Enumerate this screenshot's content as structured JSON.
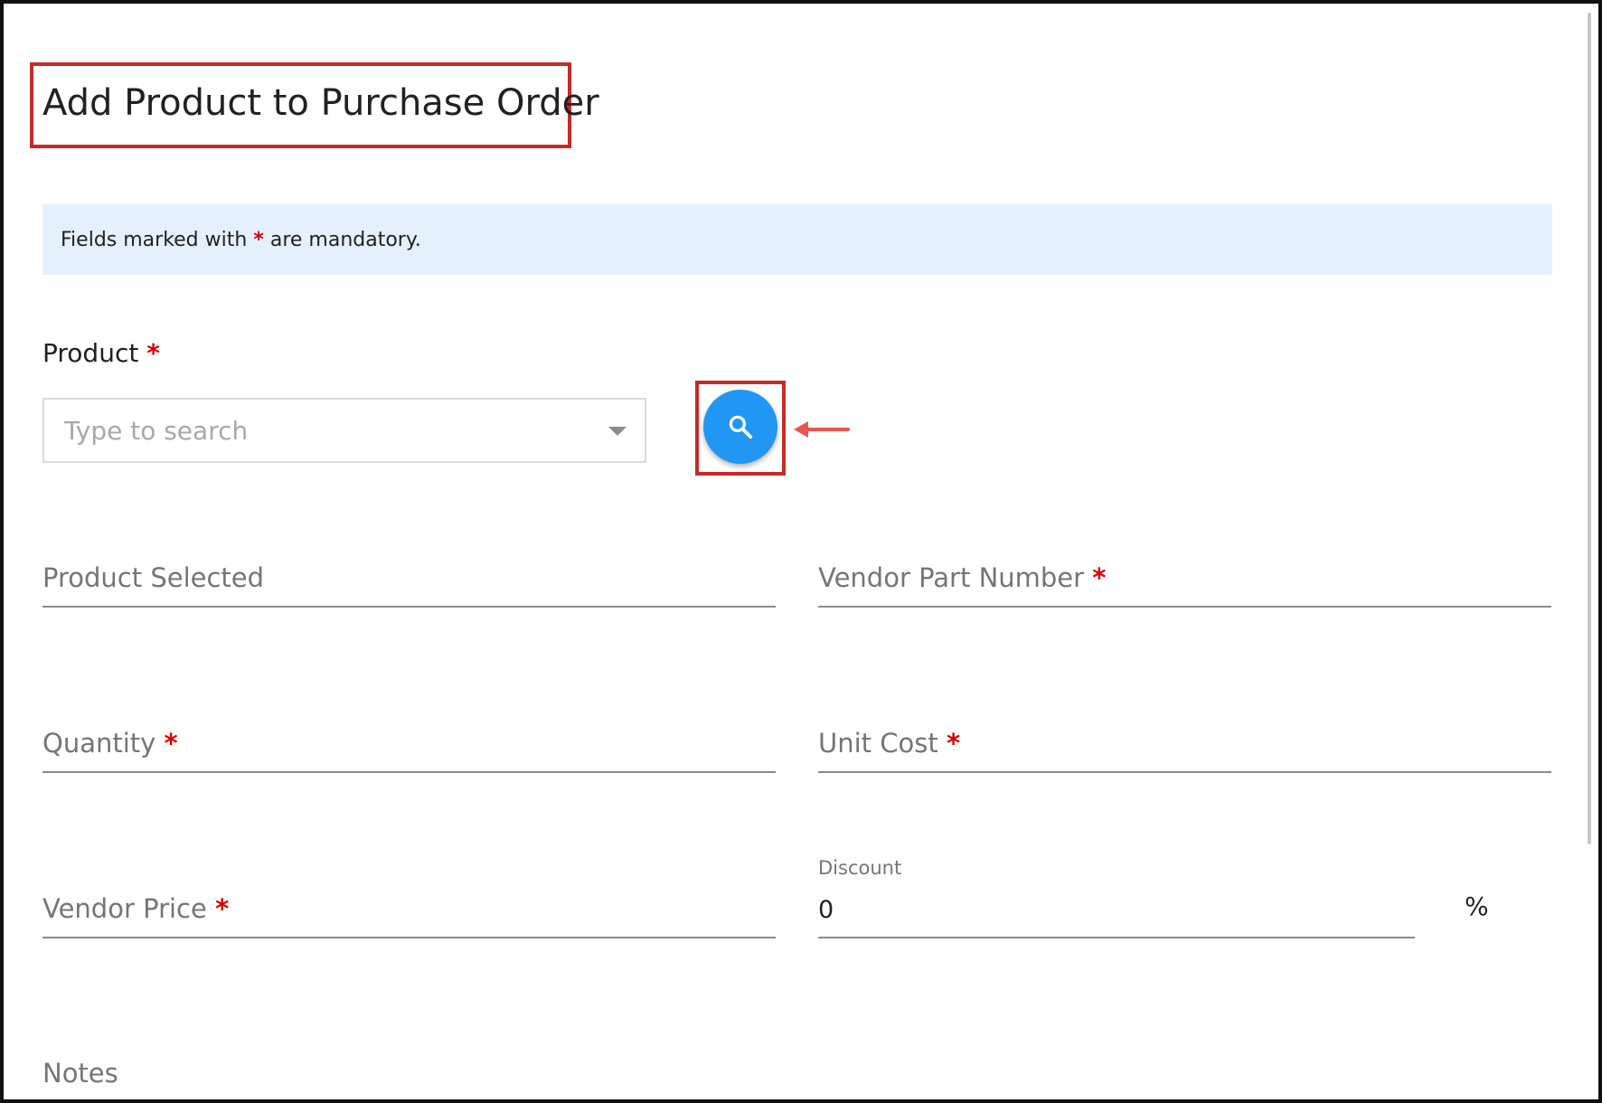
{
  "page": {
    "title": "Add Product to Purchase Order"
  },
  "banner": {
    "text_before": "Fields marked with",
    "asterisk": "*",
    "text_after": "are mandatory."
  },
  "product": {
    "label": "Product",
    "required_mark": "*",
    "placeholder": "Type to search",
    "value": ""
  },
  "search_button": {
    "icon": "search-icon",
    "aria_label": "Search products"
  },
  "fields": {
    "product_selected": {
      "label": "Product Selected"
    },
    "vendor_part_number": {
      "label": "Vendor Part Number",
      "required_mark": "*"
    },
    "quantity": {
      "label": "Quantity",
      "required_mark": "*"
    },
    "unit_cost": {
      "label": "Unit Cost",
      "required_mark": "*"
    },
    "vendor_price": {
      "label": "Vendor Price",
      "required_mark": "*"
    },
    "discount": {
      "label": "Discount",
      "value": "0",
      "suffix": "%"
    },
    "notes": {
      "label": "Notes"
    }
  },
  "colors": {
    "accent": "#2196f3",
    "required": "#d50000",
    "highlight": "#c62a2a",
    "arrow": "#e8574f",
    "banner_bg": "#e4f1fd"
  }
}
